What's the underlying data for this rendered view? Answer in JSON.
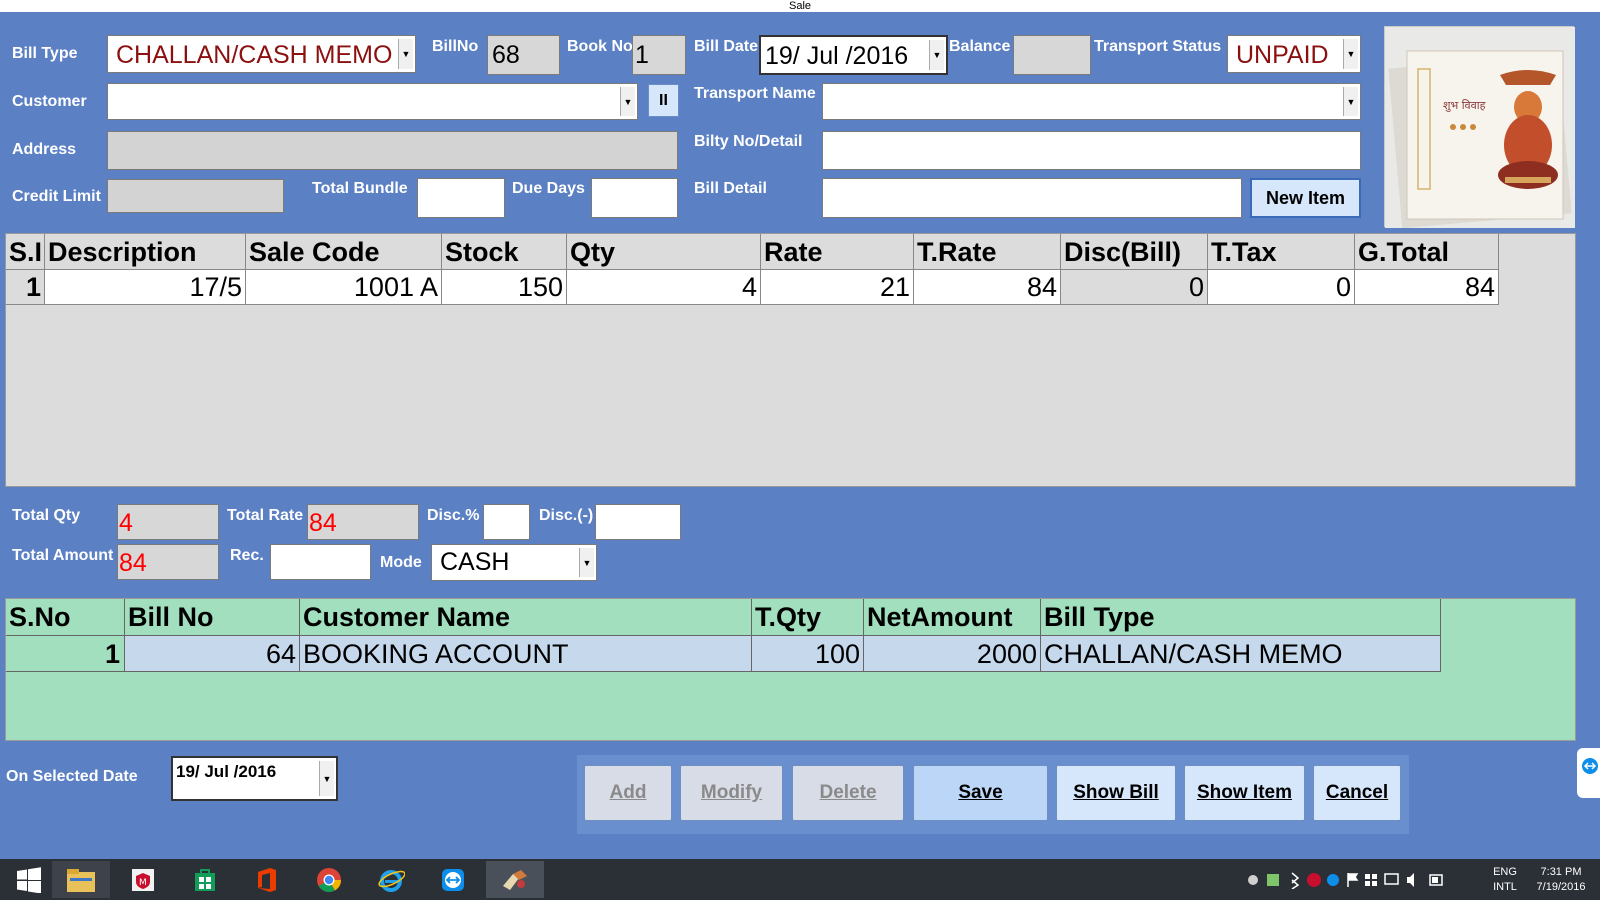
{
  "window_title": "Sale",
  "form": {
    "bill_type_label": "Bill Type",
    "bill_type_value": "CHALLAN/CASH MEMO",
    "billno_label": "BillNo",
    "billno_value": "68",
    "bookno_label": "Book No",
    "bookno_value": "1",
    "bill_date_label": "Bill Date",
    "bill_date_value": "19/ Jul /2016",
    "balance_label": "Balance",
    "balance_value": "",
    "transport_status_label": "Transport Status",
    "transport_status_value": "UNPAID",
    "customer_label": "Customer",
    "customer_value": "",
    "pause_button": "II",
    "transport_name_label": "Transport Name",
    "transport_name_value": "",
    "address_label": "Address",
    "address_value": "",
    "bilty_label": "Bilty No/Detail",
    "bilty_value": "",
    "credit_limit_label": "Credit Limit",
    "credit_limit_value": "",
    "total_bundle_label": "Total Bundle",
    "total_bundle_value": "",
    "due_days_label": "Due Days",
    "due_days_value": "",
    "bill_detail_label": "Bill Detail",
    "bill_detail_value": "",
    "new_item_button": "New Item"
  },
  "items_grid": {
    "headers": [
      "S.I",
      "Description",
      "Sale Code",
      "Stock",
      "Qty",
      "Rate",
      "T.Rate",
      "Disc(Bill)",
      "T.Tax",
      "G.Total"
    ],
    "rows": [
      [
        "1",
        "17/5",
        "1001 A",
        "150",
        "4",
        "21",
        "84",
        "0",
        "0",
        "84"
      ]
    ]
  },
  "totals": {
    "total_qty_label": "Total Qty",
    "total_qty_value": "4",
    "total_rate_label": "Total Rate",
    "total_rate_value": "84",
    "disc_pct_label": "Disc.%",
    "disc_pct_value": "",
    "disc_minus_label": "Disc.(-)",
    "disc_minus_value": "",
    "total_amount_label": "Total Amount",
    "total_amount_value": "84",
    "rec_label": "Rec.",
    "rec_value": "",
    "mode_label": "Mode",
    "mode_value": "CASH"
  },
  "bills_grid": {
    "headers": [
      "S.No",
      "Bill No",
      "Customer Name",
      "T.Qty",
      "NetAmount",
      "Bill Type"
    ],
    "rows": [
      [
        "1",
        "64",
        "BOOKING ACCOUNT",
        "100",
        "2000",
        "CHALLAN/CASH MEMO"
      ]
    ]
  },
  "footer": {
    "on_selected_date_label": "On Selected Date",
    "selected_date_value": "19/ Jul /2016",
    "buttons": {
      "add": "Add",
      "modify": "Modify",
      "delete": "Delete",
      "save": "Save",
      "show_bill": "Show Bill",
      "show_item": "Show Item",
      "cancel": "Cancel"
    }
  },
  "taskbar": {
    "language_top": "ENG",
    "language_bottom": "INTL",
    "time": "7:31 PM",
    "date": "7/19/2016"
  },
  "colors": {
    "form_background": "#5b80c4",
    "items_grid": "#dcdcdc",
    "bills_grid": "#a1dfbe",
    "highlight_red": "#ff0000",
    "dark_red": "#8b1010"
  }
}
